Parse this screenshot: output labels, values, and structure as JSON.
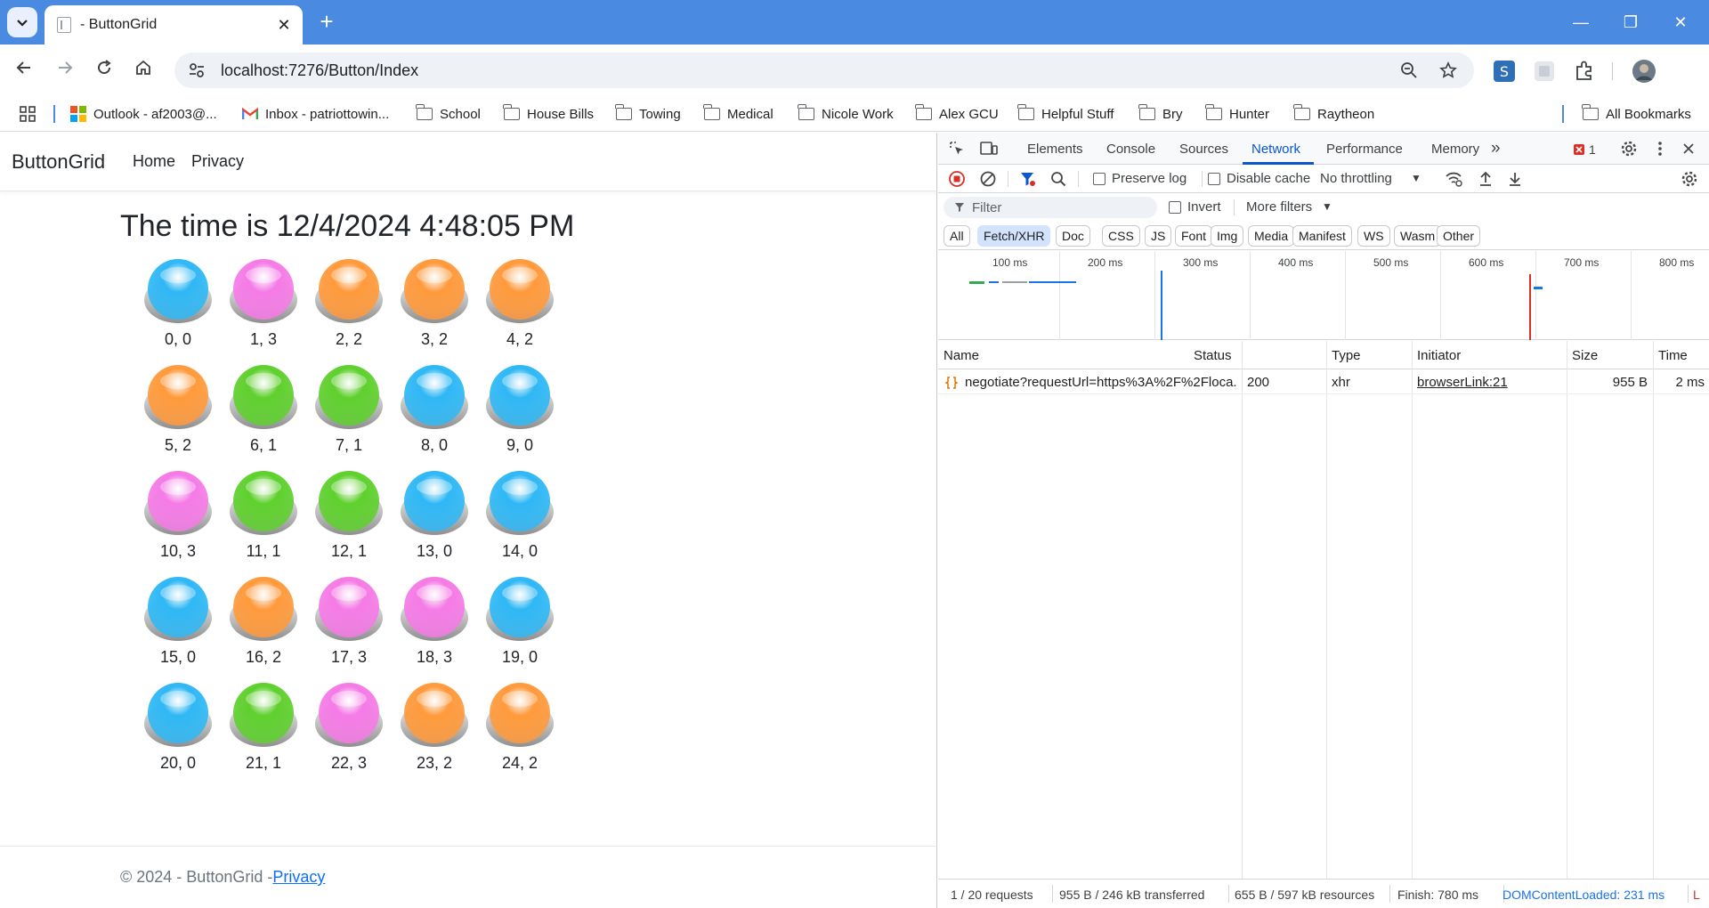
{
  "browser": {
    "tab_title": "- ButtonGrid",
    "tab_close": "✕",
    "new_tab": "+",
    "url": "localhost:7276/Button/Index",
    "window_controls": [
      "—",
      "❐",
      "✕"
    ]
  },
  "bookmarks": {
    "apps_icon": "apps-grid-icon",
    "items": [
      {
        "label": "Outlook - af2003@...",
        "icon": "microsoft-icon"
      },
      {
        "label": "Inbox - patriottowin...",
        "icon": "gmail-icon"
      },
      {
        "label": "School",
        "icon": "folder-icon"
      },
      {
        "label": "House Bills",
        "icon": "folder-icon"
      },
      {
        "label": "Towing",
        "icon": "folder-icon"
      },
      {
        "label": "Medical",
        "icon": "folder-icon"
      },
      {
        "label": "Nicole Work",
        "icon": "folder-icon"
      },
      {
        "label": "Alex GCU",
        "icon": "folder-icon"
      },
      {
        "label": "Helpful Stuff",
        "icon": "folder-icon"
      },
      {
        "label": "Bry",
        "icon": "folder-icon"
      },
      {
        "label": "Hunter",
        "icon": "folder-icon"
      },
      {
        "label": "Raytheon",
        "icon": "folder-icon"
      }
    ],
    "all_bookmarks": "All Bookmarks"
  },
  "site": {
    "brand": "ButtonGrid",
    "nav": [
      "Home",
      "Privacy"
    ],
    "heading": "The time is 12/4/2024 4:48:05 PM",
    "colors": {
      "0": "#2fb8f5",
      "1": "#5fd02e",
      "2": "#ff9a3c",
      "3": "#f57be6"
    },
    "buttons": [
      {
        "label": "0, 0",
        "state": 0
      },
      {
        "label": "1, 3",
        "state": 3
      },
      {
        "label": "2, 2",
        "state": 2
      },
      {
        "label": "3, 2",
        "state": 2
      },
      {
        "label": "4, 2",
        "state": 2
      },
      {
        "label": "5, 2",
        "state": 2
      },
      {
        "label": "6, 1",
        "state": 1
      },
      {
        "label": "7, 1",
        "state": 1
      },
      {
        "label": "8, 0",
        "state": 0
      },
      {
        "label": "9, 0",
        "state": 0
      },
      {
        "label": "10, 3",
        "state": 3
      },
      {
        "label": "11, 1",
        "state": 1
      },
      {
        "label": "12, 1",
        "state": 1
      },
      {
        "label": "13, 0",
        "state": 0
      },
      {
        "label": "14, 0",
        "state": 0
      },
      {
        "label": "15, 0",
        "state": 0
      },
      {
        "label": "16, 2",
        "state": 2
      },
      {
        "label": "17, 3",
        "state": 3
      },
      {
        "label": "18, 3",
        "state": 3
      },
      {
        "label": "19, 0",
        "state": 0
      },
      {
        "label": "20, 0",
        "state": 0
      },
      {
        "label": "21, 1",
        "state": 1
      },
      {
        "label": "22, 3",
        "state": 3
      },
      {
        "label": "23, 2",
        "state": 2
      },
      {
        "label": "24, 2",
        "state": 2
      }
    ],
    "footer_text": "© 2024 - ButtonGrid -",
    "footer_link": "Privacy"
  },
  "devtools": {
    "tabs": [
      "Elements",
      "Console",
      "Sources",
      "Network",
      "Performance",
      "Memory"
    ],
    "active_tab": "Network",
    "more_tabs": "»",
    "error_count": "1",
    "preserve_log": "Preserve log",
    "disable_cache": "Disable cache",
    "throttling": "No throttling",
    "filter_placeholder": "Filter",
    "invert": "Invert",
    "more_filters": "More filters",
    "type_filters": [
      "All",
      "Fetch/XHR",
      "Doc",
      "CSS",
      "JS",
      "Font",
      "Img",
      "Media",
      "Manifest",
      "WS",
      "Wasm",
      "Other"
    ],
    "active_filter": "Fetch/XHR",
    "timeline_labels": [
      "100 ms",
      "200 ms",
      "300 ms",
      "400 ms",
      "500 ms",
      "600 ms",
      "700 ms",
      "800 ms"
    ],
    "columns": [
      "Name",
      "Status",
      "Type",
      "Initiator",
      "Size",
      "Time"
    ],
    "rows": [
      {
        "name": "negotiate?requestUrl=https%3A%2F%2Floca...",
        "status": "200",
        "type": "xhr",
        "initiator": "browserLink:21",
        "size": "955 B",
        "time": "2 ms"
      }
    ],
    "status_bar": {
      "requests": "1 / 20 requests",
      "transferred": "955 B / 246 kB transferred",
      "resources": "655 B / 597 kB resources",
      "finish": "Finish: 780 ms",
      "dcl": "DOMContentLoaded: 231 ms",
      "load": "L"
    }
  }
}
